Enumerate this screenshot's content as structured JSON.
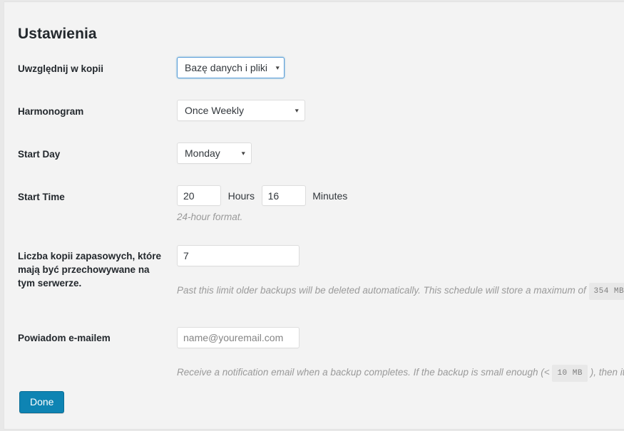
{
  "page": {
    "title": "Ustawienia"
  },
  "fields": {
    "include_in_backup": {
      "label": "Uwzględnij w kopii",
      "value": "Bazę danych i pliki",
      "caret": "▾",
      "focused": true
    },
    "schedule": {
      "label": "Harmonogram",
      "value": "Once Weekly",
      "caret": "▾"
    },
    "start_day": {
      "label": "Start Day",
      "value": "Monday",
      "caret": "▾"
    },
    "start_time": {
      "label": "Start Time",
      "hours_value": "20",
      "hours_unit": "Hours",
      "minutes_value": "16",
      "minutes_unit": "Minutes",
      "description": "24-hour format."
    },
    "backup_count": {
      "label": "Liczba kopii zapasowych, które mają być przechowywane na tym serwerze.",
      "value": "7",
      "description_before": "Past this limit older backups will be deleted automatically. This schedule will store a maximum of",
      "size_badge": "354 MB"
    },
    "notify_email": {
      "label": "Powiadom e-mailem",
      "value": "",
      "placeholder": "name@youremail.com",
      "description_before": "Receive a notification email when a backup completes. If the backup is small enough (<",
      "size_badge": "10 MB",
      "description_after": "), then it wil"
    }
  },
  "actions": {
    "done_label": "Done"
  },
  "colors": {
    "page_background": "#f3f3f3",
    "accent_button": "#0e84b3",
    "focus_border": "#5b9dd9",
    "label_text": "#23282d",
    "description_text": "#9a9a9a",
    "badge_background": "#e8e8e8"
  }
}
